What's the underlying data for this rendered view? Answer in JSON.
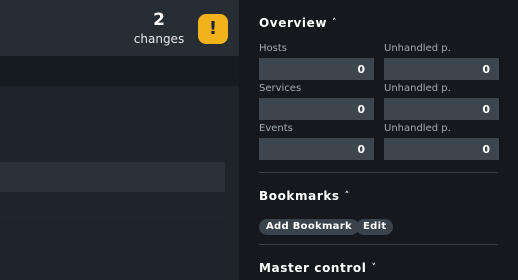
{
  "header": {
    "changes_count": "2",
    "changes_label": "changes",
    "warning_glyph": "!"
  },
  "sidebar": {
    "overview": {
      "title": "Overview",
      "stats": [
        {
          "label": "Hosts",
          "value": "0",
          "unhandled_label": "Unhandled p.",
          "unhandled_value": "0"
        },
        {
          "label": "Services",
          "value": "0",
          "unhandled_label": "Unhandled p.",
          "unhandled_value": "0"
        },
        {
          "label": "Events",
          "value": "0",
          "unhandled_label": "Unhandled p.",
          "unhandled_value": "0"
        }
      ]
    },
    "bookmarks": {
      "title": "Bookmarks",
      "add_label": "Add Bookmark",
      "edit_label": "Edit"
    },
    "master_control": {
      "title": "Master control"
    }
  },
  "colors": {
    "warning": "#f1b21b",
    "sidebar_bg": "#15191d",
    "stat_box": "#3d464e"
  }
}
